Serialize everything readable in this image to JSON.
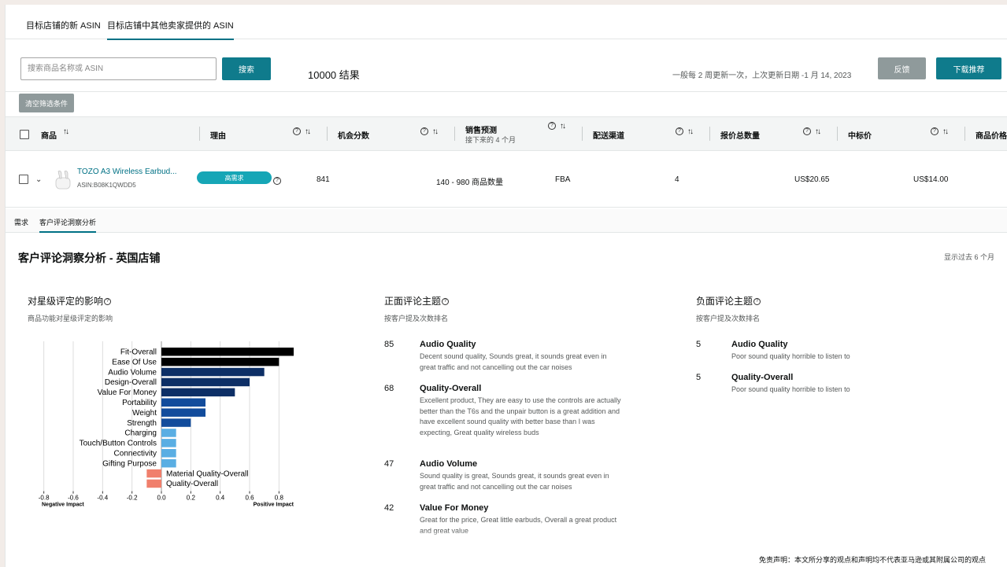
{
  "top_tabs": [
    "目标店铺的新 ASIN",
    "目标店铺中其他卖家提供的 ASIN"
  ],
  "search": {
    "placeholder": "搜索商品名称或 ASIN",
    "button": "搜索"
  },
  "results_text": "10000 结果",
  "update_note": "一般每 2 周更新一次，上次更新日期 -1 月 14, 2023",
  "feedback_button": "反馈",
  "download_button": "下载推荐",
  "clear_filters_button": "清空筛选条件",
  "columns": {
    "product": "商品",
    "reason": "理由",
    "opportunity_score": "机会分数",
    "sales_forecast": "销售预测",
    "sales_forecast_sub": "接下来的 4 个月",
    "fulfillment": "配送渠道",
    "offer_count": "报价总数量",
    "winning_price": "中标价",
    "product_price": "商品价格"
  },
  "row": {
    "title": "TOZO A3 Wireless  Earbud...",
    "asin": "ASIN:B08K1QWDD5",
    "reason_badge": "高需求",
    "opportunity_score": "841",
    "sales_forecast": "140 - 980 商品数量",
    "fulfillment": "FBA",
    "offer_count": "4",
    "winning_price": "US$20.65",
    "product_price": "US$14.00"
  },
  "sub_tabs": [
    "需求",
    "客户评论洞察分析"
  ],
  "section_title": "客户评论洞察分析 - 英国店铺",
  "range_note": "显示过去 6 个月",
  "star_impact": {
    "title": "对星级评定的影响",
    "subtitle": "商品功能对星级评定的影响"
  },
  "positive": {
    "title": "正面评论主题",
    "subtitle": "按客户提及次数排名",
    "themes": [
      {
        "count": "85",
        "name": "Audio Quality",
        "quote": "Decent sound quality, Sounds great, it sounds great even in great traffic and not cancelling out the car noises"
      },
      {
        "count": "68",
        "name": "Quality-Overall",
        "quote": "Excellent product, They are easy to use the controls are actually better than the T6s and the unpair button is a great addition and have excellent sound quality with better base than I was expecting, Great quality wireless buds"
      },
      {
        "count": "47",
        "name": "Audio Volume",
        "quote": "Sound quality is great, Sounds great, it sounds great even in great traffic and not cancelling out the car noises"
      },
      {
        "count": "42",
        "name": "Value For Money",
        "quote": "Great for the price, Great little earbuds, Overall a great product and great value"
      }
    ]
  },
  "negative": {
    "title": "负面评论主题",
    "subtitle": "按客户提及次数排名",
    "themes": [
      {
        "count": "5",
        "name": "Audio Quality",
        "quote": "Poor sound quality horrible to listen to"
      },
      {
        "count": "5",
        "name": "Quality-Overall",
        "quote": "Poor sound quality horrible to listen to"
      }
    ]
  },
  "disclaimer": "免责声明：本文所分享的观点和声明均不代表亚马逊或其附属公司的观点",
  "colors": {
    "accent": "#0f7b8c",
    "link": "#007185",
    "badge": "#16a6b6",
    "bar_strong": "#000000",
    "bar_dark": "#0d2f66",
    "bar_mid": "#124c9c",
    "bar_light": "#5aaee3",
    "bar_negative": "#f07f6c"
  },
  "chart_data": {
    "type": "bar",
    "orientation": "horizontal",
    "categories": [
      "Fit-Overall",
      "Ease Of Use",
      "Audio Volume",
      "Design-Overall",
      "Value For Money",
      "Portability",
      "Weight",
      "Strength",
      "Charging",
      "Touch/Button Controls",
      "Connectivity",
      "Gifting Purpose",
      "Material Quality-Overall",
      "Quality-Overall"
    ],
    "values": [
      0.9,
      0.8,
      0.7,
      0.6,
      0.5,
      0.3,
      0.3,
      0.2,
      0.1,
      0.1,
      0.1,
      0.1,
      -0.1,
      -0.1
    ],
    "xlim": [
      -0.9,
      0.9
    ],
    "xticks": [
      "-0.8",
      "-0.6",
      "-0.4",
      "-0.2",
      "0.0",
      "0.2",
      "0.4",
      "0.6",
      "0.8"
    ],
    "xtick_values": [
      -0.8,
      -0.6,
      -0.4,
      -0.2,
      0.0,
      0.2,
      0.4,
      0.6,
      0.8
    ],
    "left_label": "Negative Impact",
    "right_label": "Positive Impact",
    "grid": true
  }
}
